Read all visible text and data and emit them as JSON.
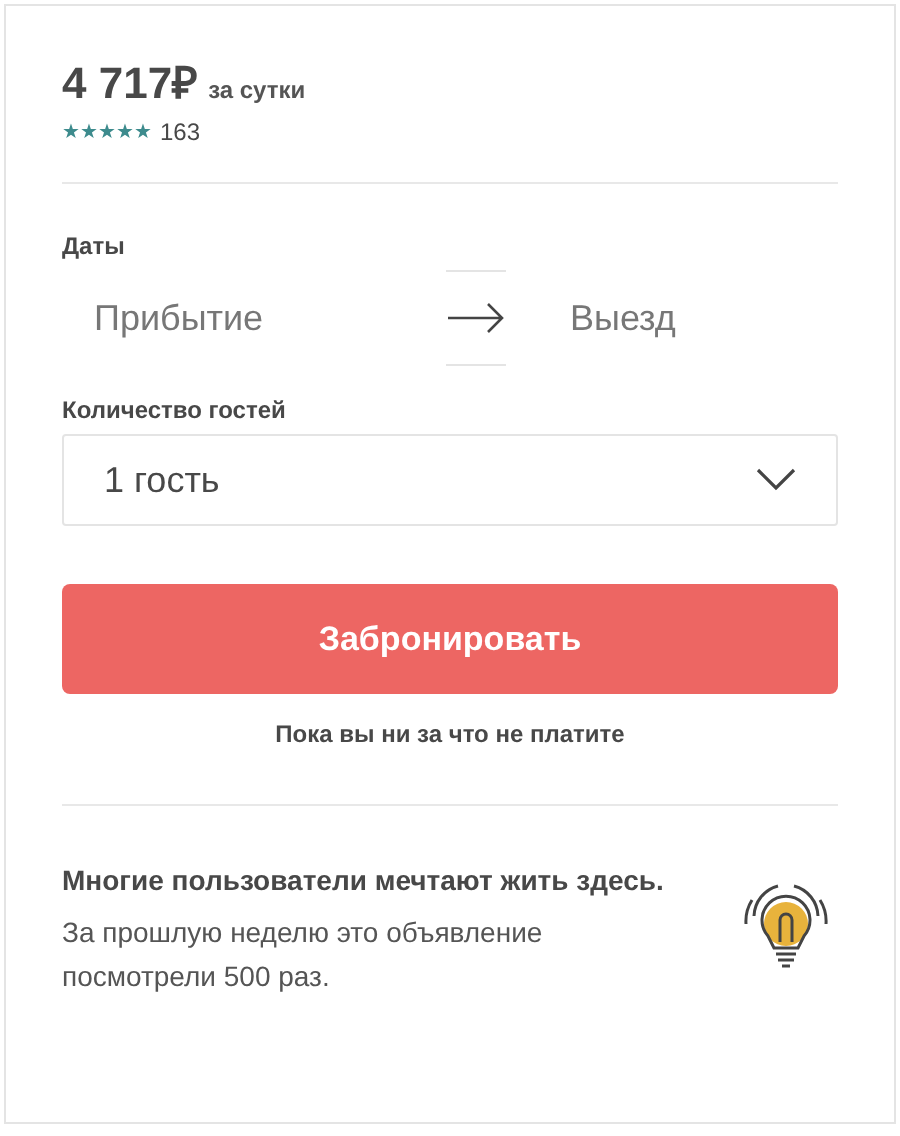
{
  "price": {
    "amount": "4 717₽",
    "period": "за сутки"
  },
  "rating": {
    "stars": 5,
    "count": "163"
  },
  "dates": {
    "label": "Даты",
    "check_in": {
      "placeholder": "Прибытие"
    },
    "check_out": {
      "placeholder": "Выезд"
    }
  },
  "guests": {
    "label": "Количество гостей",
    "value": "1 гость"
  },
  "book_button": "Забронировать",
  "note": "Пока вы ни за что не платите",
  "tip": {
    "title": "Многие пользователи мечтают жить здесь.",
    "text": "За прошлую неделю это объявление посмотрели 500 раз."
  }
}
